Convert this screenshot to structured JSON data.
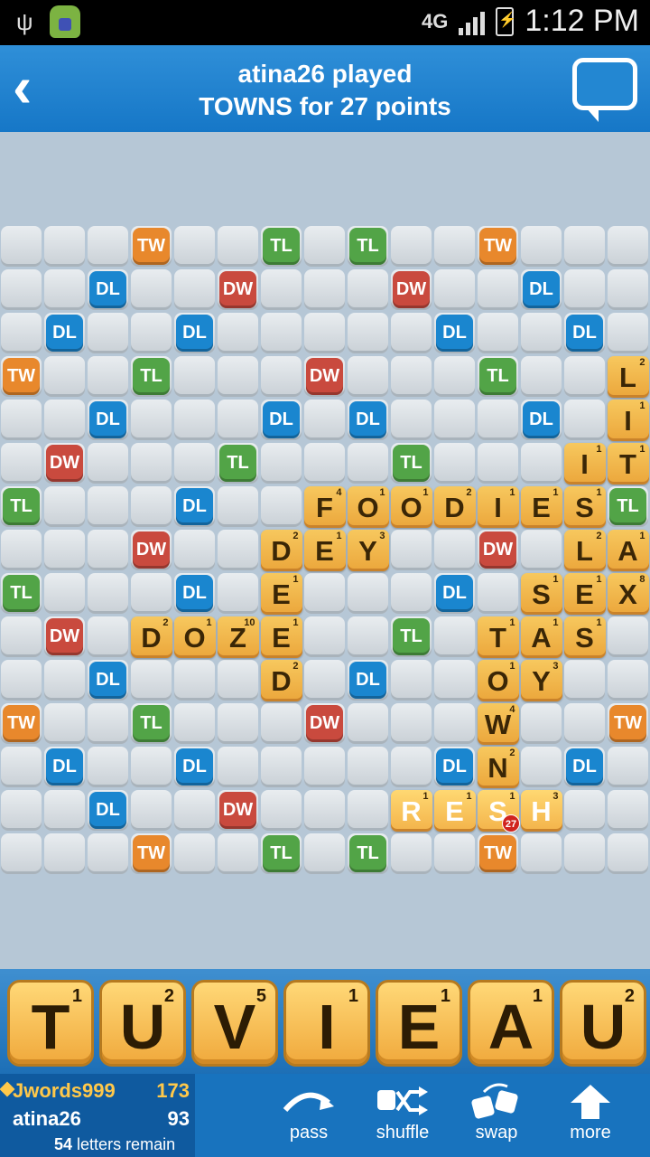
{
  "status_bar": {
    "network": "4G",
    "time": "1:12 PM"
  },
  "header": {
    "back_icon": "chevron-left-icon",
    "line1": "atina26 played",
    "line2": "TOWNS for 27 points",
    "chat_icon": "chat-bubble-icon"
  },
  "board": {
    "colors": {
      "TW": "#e8882c",
      "DW": "#c94a3e",
      "TL": "#52a447",
      "DL": "#1a86cf",
      "tile": "#f0b04a"
    },
    "bonus_rows": [
      "...TW..TL.TL..TW...",
      "..DL..DW...DW..DL..",
      ".DL..DL......DL..DL."
    ],
    "bonus_squares": [
      [
        "TW",
        0,
        3
      ],
      [
        "TL",
        0,
        6
      ],
      [
        "TL",
        0,
        8
      ],
      [
        "TW",
        0,
        11
      ],
      [
        "DL",
        1,
        2
      ],
      [
        "DW",
        1,
        5
      ],
      [
        "DW",
        1,
        9
      ],
      [
        "DL",
        1,
        12
      ],
      [
        "DL",
        2,
        1
      ],
      [
        "DL",
        2,
        4
      ],
      [
        "DL",
        2,
        10
      ],
      [
        "DL",
        2,
        13
      ],
      [
        "TW",
        3,
        0
      ],
      [
        "TL",
        3,
        3
      ],
      [
        "DW",
        3,
        7
      ],
      [
        "TL",
        3,
        11
      ],
      [
        "DL",
        4,
        2
      ],
      [
        "DL",
        4,
        6
      ],
      [
        "DL",
        4,
        8
      ],
      [
        "DL",
        4,
        12
      ],
      [
        "DW",
        5,
        1
      ],
      [
        "TL",
        5,
        5
      ],
      [
        "TL",
        5,
        9
      ],
      [
        "DW",
        5,
        13
      ],
      [
        "TL",
        6,
        0
      ],
      [
        "DL",
        6,
        4
      ],
      [
        "TL",
        6,
        14
      ],
      [
        "DW",
        7,
        3
      ],
      [
        "DW",
        7,
        11
      ],
      [
        "TL",
        8,
        0
      ],
      [
        "DL",
        8,
        4
      ],
      [
        "DL",
        8,
        10
      ],
      [
        "DW",
        9,
        1
      ],
      [
        "TL",
        9,
        9
      ],
      [
        "DL",
        10,
        2
      ],
      [
        "DL",
        10,
        8
      ],
      [
        "TW",
        11,
        0
      ],
      [
        "TL",
        11,
        3
      ],
      [
        "DW",
        11,
        7
      ],
      [
        "TW",
        11,
        14
      ],
      [
        "DL",
        12,
        1
      ],
      [
        "DL",
        12,
        4
      ],
      [
        "DL",
        12,
        10
      ],
      [
        "DL",
        12,
        13
      ],
      [
        "DL",
        13,
        2
      ],
      [
        "DW",
        13,
        5
      ],
      [
        "TW",
        14,
        3
      ],
      [
        "TL",
        14,
        6
      ],
      [
        "TL",
        14,
        8
      ],
      [
        "TW",
        14,
        11
      ]
    ],
    "tiles": [
      {
        "letter": "L",
        "score": "2",
        "r": 3,
        "c": 14
      },
      {
        "letter": "I",
        "score": "1",
        "r": 4,
        "c": 14
      },
      {
        "letter": "I",
        "score": "1",
        "r": 5,
        "c": 13
      },
      {
        "letter": "T",
        "score": "1",
        "r": 5,
        "c": 14
      },
      {
        "letter": "F",
        "score": "4",
        "r": 6,
        "c": 7
      },
      {
        "letter": "O",
        "score": "1",
        "r": 6,
        "c": 8
      },
      {
        "letter": "O",
        "score": "1",
        "r": 6,
        "c": 9
      },
      {
        "letter": "D",
        "score": "2",
        "r": 6,
        "c": 10
      },
      {
        "letter": "I",
        "score": "1",
        "r": 6,
        "c": 11
      },
      {
        "letter": "E",
        "score": "1",
        "r": 6,
        "c": 12
      },
      {
        "letter": "S",
        "score": "1",
        "r": 6,
        "c": 13
      },
      {
        "letter": "D",
        "score": "2",
        "r": 7,
        "c": 6
      },
      {
        "letter": "E",
        "score": "1",
        "r": 7,
        "c": 7
      },
      {
        "letter": "Y",
        "score": "3",
        "r": 7,
        "c": 8
      },
      {
        "letter": "L",
        "score": "2",
        "r": 7,
        "c": 13
      },
      {
        "letter": "A",
        "score": "1",
        "r": 7,
        "c": 14
      },
      {
        "letter": "E",
        "score": "1",
        "r": 8,
        "c": 6
      },
      {
        "letter": "S",
        "score": "1",
        "r": 8,
        "c": 12
      },
      {
        "letter": "E",
        "score": "1",
        "r": 8,
        "c": 13
      },
      {
        "letter": "X",
        "score": "8",
        "r": 8,
        "c": 14
      },
      {
        "letter": "D",
        "score": "2",
        "r": 9,
        "c": 3
      },
      {
        "letter": "O",
        "score": "1",
        "r": 9,
        "c": 4
      },
      {
        "letter": "Z",
        "score": "10",
        "r": 9,
        "c": 5
      },
      {
        "letter": "E",
        "score": "1",
        "r": 9,
        "c": 6
      },
      {
        "letter": "T",
        "score": "1",
        "r": 9,
        "c": 11
      },
      {
        "letter": "A",
        "score": "1",
        "r": 9,
        "c": 12
      },
      {
        "letter": "S",
        "score": "1",
        "r": 9,
        "c": 13
      },
      {
        "letter": "D",
        "score": "2",
        "r": 10,
        "c": 6
      },
      {
        "letter": "O",
        "score": "1",
        "r": 10,
        "c": 11
      },
      {
        "letter": "Y",
        "score": "3",
        "r": 10,
        "c": 12
      },
      {
        "letter": "W",
        "score": "4",
        "r": 11,
        "c": 11
      },
      {
        "letter": "N",
        "score": "2",
        "r": 12,
        "c": 11
      },
      {
        "letter": "R",
        "score": "1",
        "r": 13,
        "c": 9,
        "last": true
      },
      {
        "letter": "E",
        "score": "1",
        "r": 13,
        "c": 10,
        "last": true
      },
      {
        "letter": "S",
        "score": "1",
        "r": 13,
        "c": 11,
        "last": true
      },
      {
        "letter": "H",
        "score": "3",
        "r": 13,
        "c": 12,
        "last": true
      }
    ],
    "last_play_points": "27"
  },
  "rack": [
    {
      "letter": "T",
      "score": "1"
    },
    {
      "letter": "U",
      "score": "2"
    },
    {
      "letter": "V",
      "score": "5"
    },
    {
      "letter": "I",
      "score": "1"
    },
    {
      "letter": "E",
      "score": "1"
    },
    {
      "letter": "A",
      "score": "1"
    },
    {
      "letter": "U",
      "score": "2"
    }
  ],
  "scores": {
    "player1": {
      "name": "Jwords999",
      "score": "173"
    },
    "player2": {
      "name": "atina26",
      "score": "93"
    },
    "remain_count": "54",
    "remain_text": "letters remain"
  },
  "actions": [
    {
      "label": "pass",
      "icon": "pass-arrow-icon"
    },
    {
      "label": "shuffle",
      "icon": "shuffle-icon"
    },
    {
      "label": "swap",
      "icon": "swap-icon"
    },
    {
      "label": "more",
      "icon": "up-arrow-icon"
    }
  ]
}
